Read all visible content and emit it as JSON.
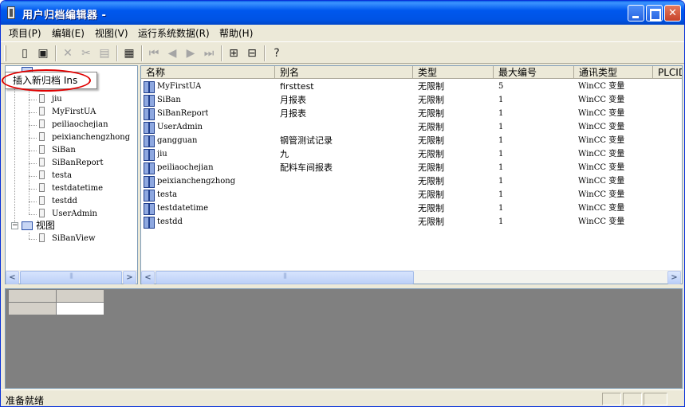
{
  "window": {
    "title": "用户归档编辑器 -"
  },
  "menu": [
    "项目(P)",
    "编辑(E)",
    "视图(V)",
    "运行系统数据(R)",
    "帮助(H)"
  ],
  "toolbar": {
    "buttons": [
      "new-archive-icon",
      "save-icon",
      "delete-icon",
      "cut-icon",
      "paste-icon",
      "table-view-icon",
      "first-record-icon",
      "previous-record-icon",
      "next-record-icon",
      "last-record-icon",
      "import-icon",
      "export-icon",
      "help-icon"
    ]
  },
  "popup": {
    "label": "插入新归档 Ins"
  },
  "tree": {
    "archives": [
      "jiu",
      "MyFirstUA",
      "peiliaochejian",
      "peixianchengzhong",
      "SiBan",
      "SiBanReport",
      "testa",
      "testdatetime",
      "testdd",
      "UserAdmin"
    ],
    "views_label": "视图",
    "views": [
      "SiBanView"
    ]
  },
  "list": {
    "columns": [
      "名称",
      "别名",
      "类型",
      "最大编号",
      "通讯类型",
      "PLCID"
    ],
    "rows": [
      [
        "MyFirstUA",
        "firsttest",
        "无限制",
        "5",
        "WinCC 变量"
      ],
      [
        "SiBan",
        "月报表",
        "无限制",
        "1",
        "WinCC 变量"
      ],
      [
        "SiBanReport",
        "月报表",
        "无限制",
        "1",
        "WinCC 变量"
      ],
      [
        "UserAdmin",
        "",
        "无限制",
        "1",
        "WinCC 变量"
      ],
      [
        "gangguan",
        "钢管测试记录",
        "无限制",
        "1",
        "WinCC 变量"
      ],
      [
        "jiu",
        "九",
        "无限制",
        "1",
        "WinCC 变量"
      ],
      [
        "peiliaochejian",
        "配料车间报表",
        "无限制",
        "1",
        "WinCC 变量"
      ],
      [
        "peixianchengzhong",
        "",
        "无限制",
        "1",
        "WinCC 变量"
      ],
      [
        "testa",
        "",
        "无限制",
        "1",
        "WinCC 变量"
      ],
      [
        "testdatetime",
        "",
        "无限制",
        "1",
        "WinCC 变量"
      ],
      [
        "testdd",
        "",
        "无限制",
        "1",
        "WinCC 变量"
      ]
    ]
  },
  "status": {
    "text": "准备就绪"
  }
}
